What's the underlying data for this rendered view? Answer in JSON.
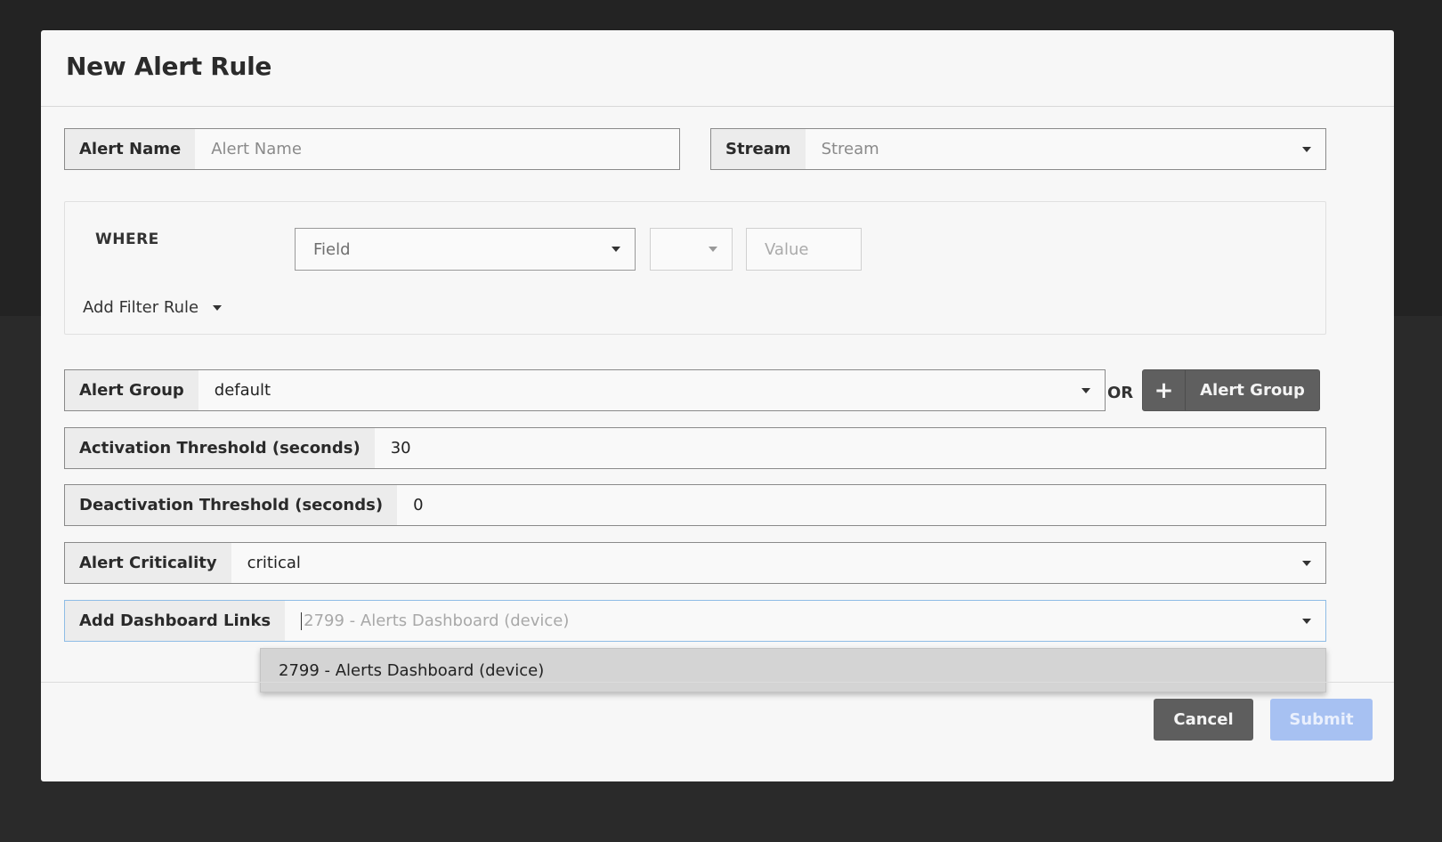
{
  "modal": {
    "title": "New Alert Rule"
  },
  "alert_name": {
    "label": "Alert Name",
    "placeholder": "Alert Name"
  },
  "stream": {
    "label": "Stream",
    "placeholder": "Stream"
  },
  "filter": {
    "where_label": "WHERE",
    "field_placeholder": "Field",
    "operator_value": "",
    "value_placeholder": "Value",
    "add_filter_label": "Add Filter Rule"
  },
  "alert_group": {
    "label": "Alert Group",
    "value": "default",
    "or_label": "OR",
    "add_button_label": "Alert Group",
    "plus_glyph": "+"
  },
  "activation": {
    "label": "Activation Threshold (seconds)",
    "value": "30"
  },
  "deactivation": {
    "label": "Deactivation Threshold (seconds)",
    "value": "0"
  },
  "criticality": {
    "label": "Alert Criticality",
    "value": "critical"
  },
  "dashboard_links": {
    "label": "Add Dashboard Links",
    "placeholder": "2799 - Alerts Dashboard (device)",
    "options": [
      "2799 - Alerts Dashboard (device)"
    ]
  },
  "footer": {
    "cancel_label": "Cancel",
    "submit_label": "Submit"
  },
  "colors": {
    "submit_disabled": "#a7c1f2",
    "button_dark": "#5e5e5e",
    "focus_border": "#8fbde6"
  }
}
